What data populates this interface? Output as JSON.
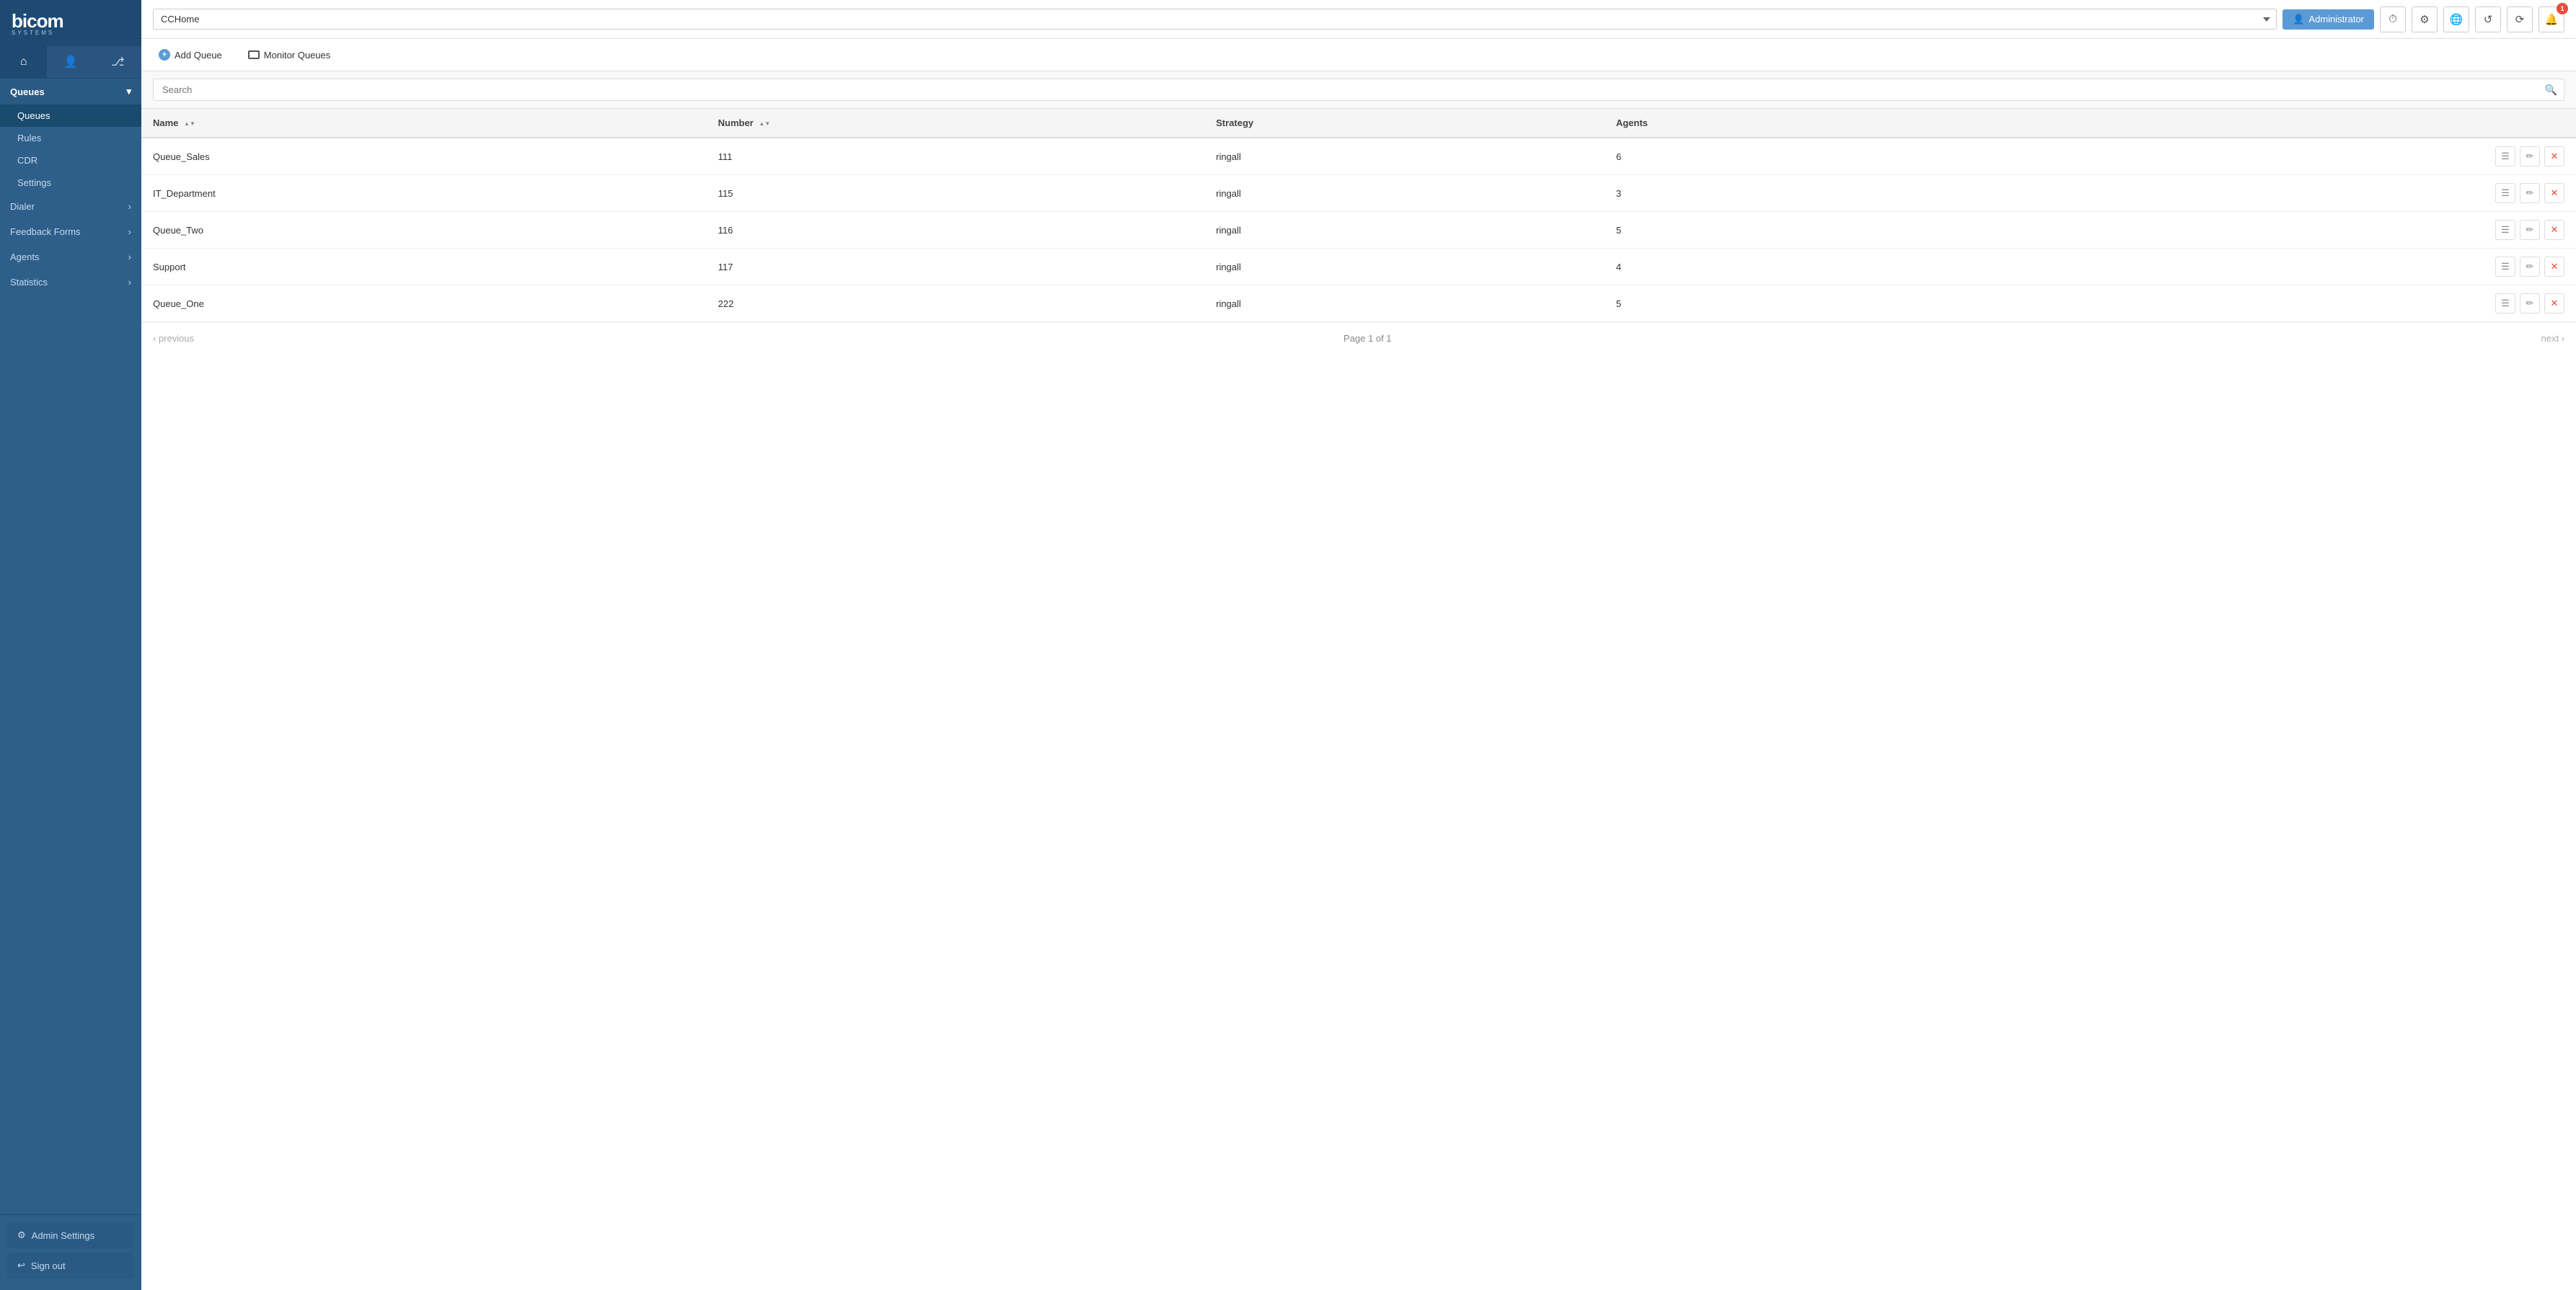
{
  "sidebar": {
    "logo": "bicom",
    "logo_sub": "SYSTEMS",
    "icons": [
      {
        "name": "home-icon",
        "symbol": "⌂"
      },
      {
        "name": "user-icon",
        "symbol": "👤"
      },
      {
        "name": "share-icon",
        "symbol": "⎇"
      }
    ],
    "groups": [
      {
        "label": "Queues",
        "name": "queues-group",
        "expanded": true,
        "items": [
          {
            "label": "Queues",
            "name": "queues-item",
            "active": true
          },
          {
            "label": "Rules",
            "name": "rules-item"
          },
          {
            "label": "CDR",
            "name": "cdr-item"
          },
          {
            "label": "Settings",
            "name": "settings-item"
          }
        ]
      },
      {
        "label": "Dialer",
        "name": "dialer-group",
        "hasArrow": true
      },
      {
        "label": "Feedback Forms",
        "name": "feedback-forms-group",
        "hasArrow": true
      },
      {
        "label": "Agents",
        "name": "agents-group",
        "hasArrow": true
      },
      {
        "label": "Statistics",
        "name": "statistics-group",
        "hasArrow": true
      }
    ],
    "bottom_buttons": [
      {
        "label": "Admin Settings",
        "name": "admin-settings-button",
        "icon": "⚙"
      },
      {
        "label": "Sign out",
        "name": "sign-out-button",
        "icon": "↩"
      }
    ]
  },
  "topbar": {
    "select_value": "CCHome",
    "user_label": "Administrator",
    "icons": [
      {
        "name": "clock-icon",
        "symbol": "⏱"
      },
      {
        "name": "settings-icon",
        "symbol": "⚙"
      },
      {
        "name": "globe-icon",
        "symbol": "🌐"
      },
      {
        "name": "refresh-alt-icon",
        "symbol": "↺"
      },
      {
        "name": "refresh-icon",
        "symbol": "⟳"
      },
      {
        "name": "bell-icon",
        "symbol": "🔔",
        "badge": "1"
      }
    ]
  },
  "action_bar": {
    "add_queue_label": "Add Queue",
    "monitor_queues_label": "Monitor Queues"
  },
  "search": {
    "placeholder": "Search"
  },
  "table": {
    "columns": [
      {
        "label": "Name",
        "name": "name-column",
        "sortable": true
      },
      {
        "label": "Number",
        "name": "number-column",
        "sortable": true
      },
      {
        "label": "Strategy",
        "name": "strategy-column",
        "sortable": false
      },
      {
        "label": "Agents",
        "name": "agents-column",
        "sortable": false
      }
    ],
    "rows": [
      {
        "name": "Queue_Sales",
        "number": "111",
        "strategy": "ringall",
        "agents": "6"
      },
      {
        "name": "IT_Department",
        "number": "115",
        "strategy": "ringall",
        "agents": "3"
      },
      {
        "name": "Queue_Two",
        "number": "116",
        "strategy": "ringall",
        "agents": "5"
      },
      {
        "name": "Support",
        "number": "117",
        "strategy": "ringall",
        "agents": "4"
      },
      {
        "name": "Queue_One",
        "number": "222",
        "strategy": "ringall",
        "agents": "5"
      }
    ]
  },
  "pagination": {
    "prev_label": "‹ previous",
    "page_info": "Page 1 of 1",
    "next_label": "next ›"
  }
}
